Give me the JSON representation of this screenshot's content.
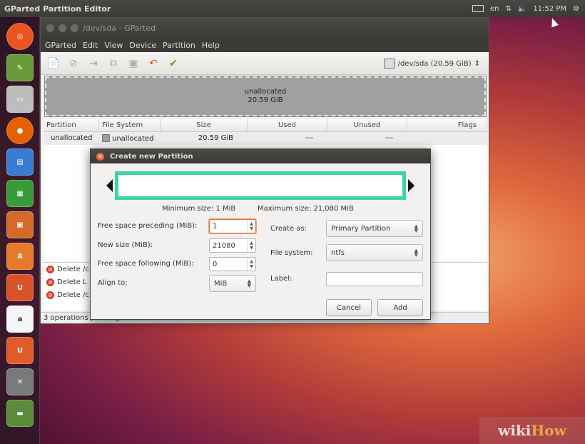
{
  "top_panel": {
    "app_title": "GParted Partition Editor",
    "keyboard_layout": "en",
    "clock": "11:52 PM"
  },
  "launcher": {
    "items": [
      {
        "icon": "dash-home-icon",
        "color": "#e95420"
      },
      {
        "icon": "app-icon",
        "color": "#6b9a3a"
      },
      {
        "icon": "files-icon",
        "color": "#a0a0a0"
      },
      {
        "icon": "firefox-icon",
        "color": "#e66000"
      },
      {
        "icon": "writer-icon",
        "color": "#3a7bd5"
      },
      {
        "icon": "calc-icon",
        "color": "#3a9a3a"
      },
      {
        "icon": "impress-icon",
        "color": "#d46a2a"
      },
      {
        "icon": "software-center-icon",
        "color": "#e67a2a"
      },
      {
        "icon": "ubuntu-one-icon",
        "color": "#d9532a"
      },
      {
        "icon": "amazon-icon",
        "color": "#f5f5f5"
      },
      {
        "icon": "ubuntu-one-icon",
        "color": "#e05a2a"
      },
      {
        "icon": "system-settings-icon",
        "color": "#7a7a7a"
      },
      {
        "icon": "gparted-icon",
        "color": "#5a8a3a"
      }
    ]
  },
  "gparted": {
    "title": "/dev/sda - GParted",
    "menu": [
      "GParted",
      "Edit",
      "View",
      "Device",
      "Partition",
      "Help"
    ],
    "device": "/dev/sda  (20.59 GiB)",
    "disk_graphic": {
      "label": "unallocated",
      "size": "20.59 GiB"
    },
    "columns": [
      "Partition",
      "File System",
      "Size",
      "Used",
      "Unused",
      "Flags"
    ],
    "rows": [
      {
        "partition": "unallocated",
        "filesystem": "unallocated",
        "size": "20.59 GiB",
        "used": "---",
        "unused": "---",
        "flags": ""
      }
    ],
    "operations": [
      "Delete /c",
      "Delete L",
      "Delete /c"
    ],
    "status": "3 operations pending"
  },
  "dialog": {
    "title": "Create new Partition",
    "min_size": "Minimum size: 1 MiB",
    "max_size": "Maximum size: 21,080 MiB",
    "labels": {
      "free_preceding": "Free space preceding (MiB):",
      "new_size": "New size (MiB):",
      "free_following": "Free space following (MiB):",
      "align_to": "Align to:",
      "create_as": "Create as:",
      "file_system": "File system:",
      "label": "Label:"
    },
    "values": {
      "free_preceding": "1",
      "new_size": "21080",
      "free_following": "0",
      "align_to": "MiB",
      "create_as": "Primary Partition",
      "file_system": "ntfs",
      "label": ""
    },
    "buttons": {
      "cancel": "Cancel",
      "add": "Add"
    },
    "highlight_color": "#3dd4a4"
  },
  "watermark": {
    "part1": "wiki",
    "part2": "How"
  }
}
